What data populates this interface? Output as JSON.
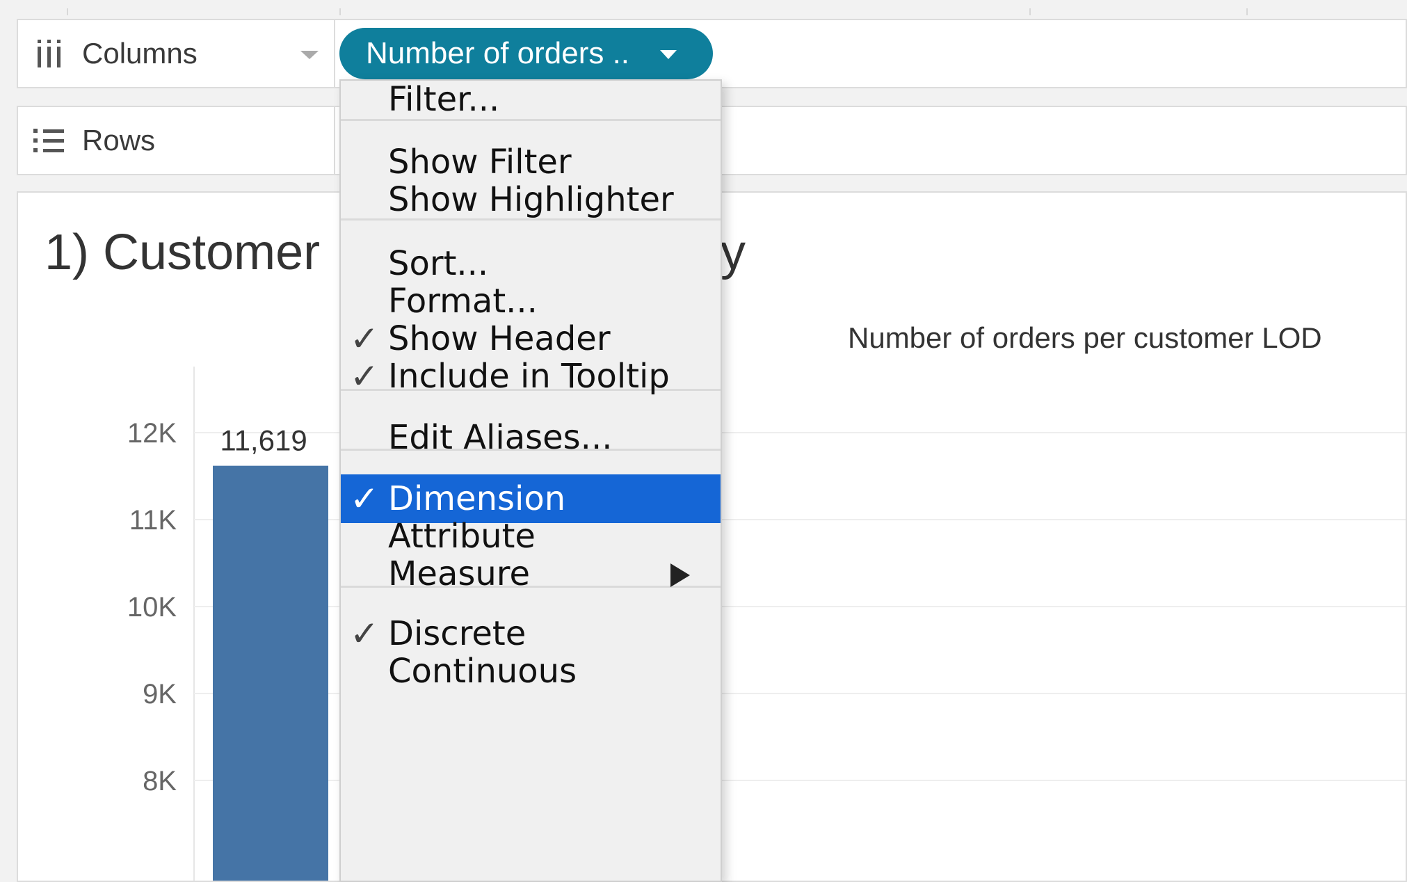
{
  "shelves": {
    "columns": {
      "label": "Columns",
      "icon": "columns-icon"
    },
    "rows": {
      "label": "Rows",
      "icon": "rows-icon"
    },
    "pill": {
      "label": "Number of orders .."
    }
  },
  "view": {
    "title_visible_start": "1) Customer",
    "title_visible_end": "y",
    "header_label": "Number of orders per customer LOD"
  },
  "menu": {
    "items": [
      {
        "label": "Filter...",
        "checked": false
      },
      {
        "label": "Show Filter",
        "checked": false
      },
      {
        "label": "Show Highlighter",
        "checked": false
      },
      {
        "label": "Sort...",
        "checked": false
      },
      {
        "label": "Format...",
        "checked": false
      },
      {
        "label": "Show Header",
        "checked": true
      },
      {
        "label": "Include in Tooltip",
        "checked": true
      },
      {
        "label": "Edit Aliases...",
        "checked": false
      },
      {
        "label": "Dimension",
        "checked": true,
        "selected": true
      },
      {
        "label": "Attribute",
        "checked": false
      },
      {
        "label": "Measure",
        "checked": false,
        "submenu": true
      },
      {
        "label": "Discrete",
        "checked": true
      },
      {
        "label": "Continuous",
        "checked": false
      }
    ],
    "check_glyph": "✓"
  },
  "chart_data": {
    "type": "bar",
    "categories": [
      ""
    ],
    "values": [
      11619
    ],
    "data_labels": [
      "11,619"
    ],
    "y_ticks": [
      "12K",
      "11K",
      "10K",
      "9K",
      "8K"
    ],
    "y_tick_values": [
      12000,
      11000,
      10000,
      9000,
      8000
    ],
    "ylim": [
      7750,
      12600
    ],
    "grid": true,
    "bar_color": "#4574a6"
  },
  "colors": {
    "pill": "#0f7f9c",
    "menu_selected": "#1566d6",
    "bar": "#4574a6"
  }
}
